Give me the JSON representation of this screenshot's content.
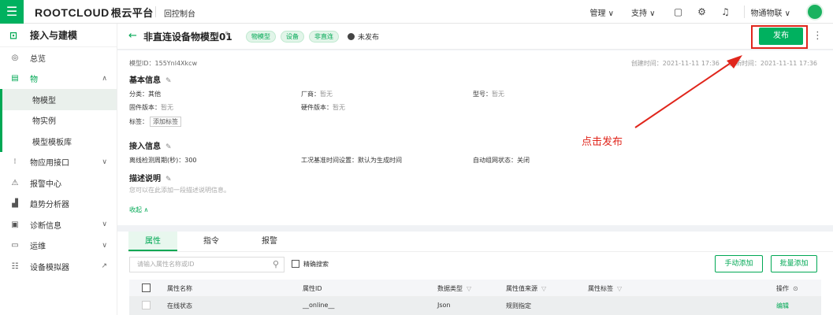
{
  "topbar": {
    "logo": "ROOTCLOUD",
    "logo_cn": "根云平台",
    "console": "回控制台",
    "menu": [
      "管理 ∨",
      "支持 ∨"
    ],
    "org": "物通物联 ∨"
  },
  "sidebar": {
    "header": "接入与建模",
    "items": [
      {
        "label": "总览"
      },
      {
        "label": "物"
      },
      {
        "label": "物模型"
      },
      {
        "label": "物实例"
      },
      {
        "label": "模型模板库"
      },
      {
        "label": "物应用接口"
      },
      {
        "label": "报警中心"
      },
      {
        "label": "趋势分析器"
      },
      {
        "label": "诊断信息"
      },
      {
        "label": "运维"
      },
      {
        "label": "设备模拟器"
      }
    ]
  },
  "header": {
    "title": "非直连设备物模型01",
    "tags": [
      "物模型",
      "设备",
      "非直连"
    ],
    "status": "未发布",
    "publish_label": "发布"
  },
  "meta": {
    "model_id": "模型ID：155Ynl4Xkcw",
    "created": "创建时间：2021-11-11 17:36",
    "updated": "更新时间：2021-11-11 17:36"
  },
  "basic": {
    "title": "基本信息",
    "category_label": "分类：",
    "category_value": "其他",
    "vendor_label": "厂商：",
    "vendor_value": "暂无",
    "model_label": "型号：",
    "model_value": "暂无",
    "firmware_label": "固件版本：",
    "firmware_value": "暂无",
    "hardware_label": "硬件版本：",
    "hardware_value": "暂无",
    "tags_label": "标签：",
    "add_tag": "添加标签"
  },
  "access": {
    "title": "接入信息",
    "offline": "离线检测周期(秒)：300",
    "baseline": "工况基准时间设置：默认为生成时间",
    "network": "自动组网状态：关闭"
  },
  "description": {
    "title": "描述说明",
    "placeholder": "您可以在此添加一段描述说明信息。",
    "collapse": "收起 ∧"
  },
  "tabs": [
    "属性",
    "指令",
    "报警"
  ],
  "toolbar": {
    "search_placeholder": "请输入属性名称或ID",
    "exact": "精确搜索",
    "manual_add": "手动添加",
    "batch_add": "批量添加"
  },
  "table": {
    "columns": [
      "属性名称",
      "属性ID",
      "数据类型",
      "属性值来源",
      "属性标签",
      "操作"
    ],
    "rows": [
      {
        "name": "在线状态",
        "id": "__online__",
        "type": "Json",
        "source": "规则指定",
        "tag": "",
        "action": "编辑"
      }
    ]
  },
  "annotation": {
    "text": "点击发布",
    "color": "#e0261c"
  },
  "colors": {
    "brand": "#00b15f",
    "accent": "#00a854"
  }
}
